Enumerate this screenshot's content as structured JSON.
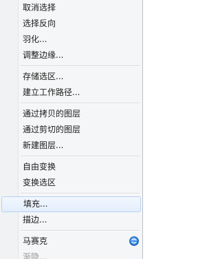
{
  "menu": {
    "groups": [
      {
        "items": [
          {
            "label": "取消选择"
          },
          {
            "label": "选择反向"
          },
          {
            "label": "羽化..."
          },
          {
            "label": "调整边缘..."
          }
        ]
      },
      {
        "items": [
          {
            "label": "存储选区..."
          },
          {
            "label": "建立工作路径..."
          }
        ]
      },
      {
        "items": [
          {
            "label": "通过拷贝的图层"
          },
          {
            "label": "通过剪切的图层"
          },
          {
            "label": "新建图层..."
          }
        ]
      },
      {
        "items": [
          {
            "label": "自由变换"
          },
          {
            "label": "变换选区"
          }
        ]
      },
      {
        "items": [
          {
            "label": "填充..."
          },
          {
            "label": "描边..."
          }
        ]
      },
      {
        "items": [
          {
            "label": "马赛克",
            "icon": "blue-circle-arrow-icon"
          },
          {
            "label": "渐隐..."
          }
        ]
      }
    ]
  },
  "colors": {
    "badge_blue": "#1a6fd0",
    "hover_border": "#b8d1f2"
  }
}
